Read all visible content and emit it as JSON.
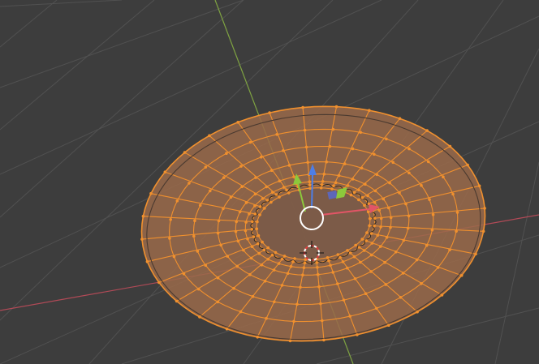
{
  "viewport": {
    "background": "#3d3d3d",
    "grid_color": "#515151",
    "x_axis_color": "#b24a57",
    "y_axis_color": "#7fa342",
    "selection_color": "#f0902e",
    "mesh_fill": "#9a6a4a"
  },
  "object": {
    "kind": "plate-mesh",
    "mode": "edit-mode",
    "selected": true
  },
  "gizmo": {
    "colors": {
      "x": "#e25566",
      "y": "#8cc83c",
      "z": "#4d7ee6",
      "view": "#5d66b8",
      "center": "#ffffff"
    }
  },
  "cursor_3d": {
    "colors": [
      "#e03b3b",
      "#ffffff"
    ]
  }
}
